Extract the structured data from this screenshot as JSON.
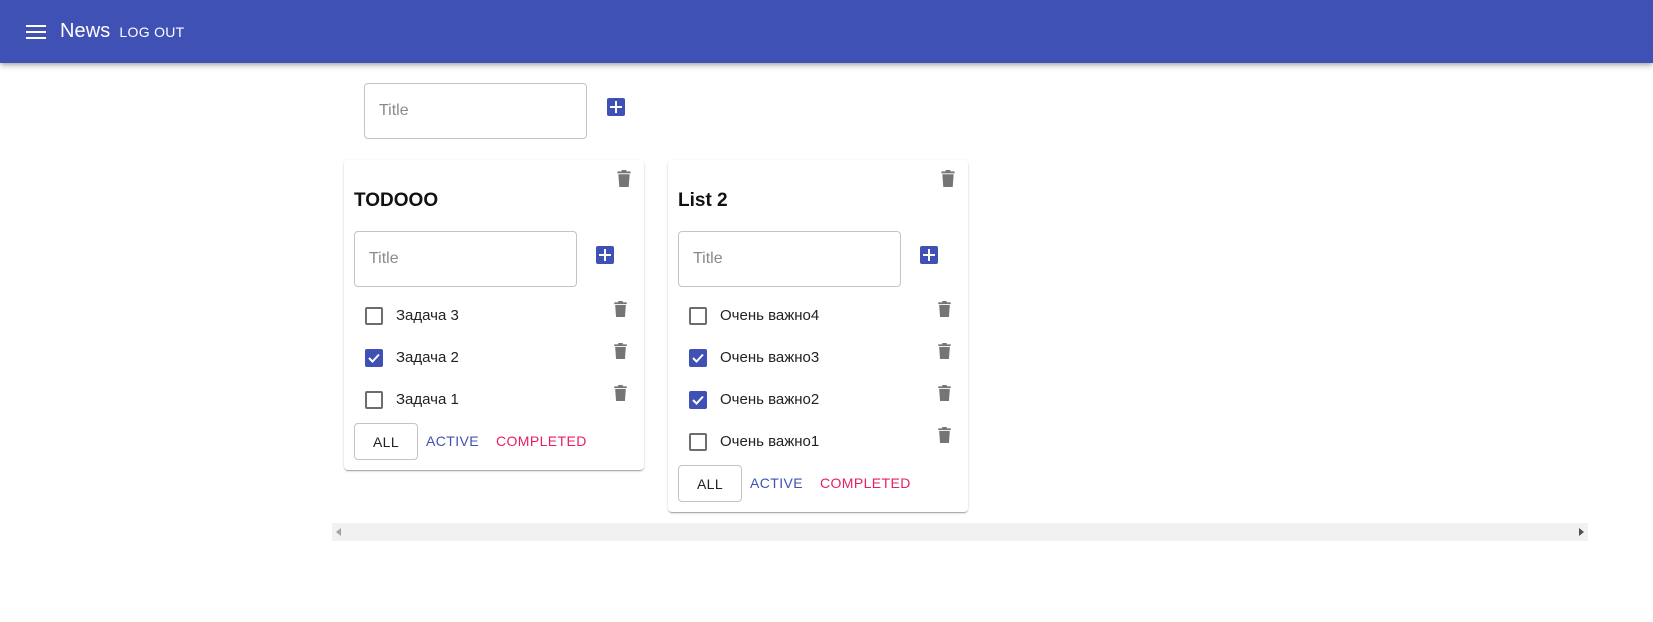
{
  "appbar": {
    "title": "News",
    "logout_label": "LOG OUT",
    "color": "#3f51b5",
    "menu_icon": "menu-icon"
  },
  "new_list": {
    "placeholder": "Title",
    "add_icon": "plus-box-icon"
  },
  "lists": [
    {
      "title": "TODOOO",
      "input_placeholder": "Title",
      "tasks": [
        {
          "label": "Задача 3",
          "checked": false
        },
        {
          "label": "Задача 2",
          "checked": true
        },
        {
          "label": "Задача 1",
          "checked": false
        }
      ],
      "filters": {
        "all": "ALL",
        "active": "ACTIVE",
        "completed": "COMPLETED"
      }
    },
    {
      "title": "List 2",
      "input_placeholder": "Title",
      "tasks": [
        {
          "label": "Очень важно4",
          "checked": false
        },
        {
          "label": "Очень важно3",
          "checked": true
        },
        {
          "label": "Очень важно2",
          "checked": true
        },
        {
          "label": "Очень важно1",
          "checked": false
        }
      ],
      "filters": {
        "all": "ALL",
        "active": "ACTIVE",
        "completed": "COMPLETED"
      }
    }
  ],
  "colors": {
    "primary": "#3f51b5",
    "secondary": "#e91e63",
    "icon_gray": "#757575"
  }
}
